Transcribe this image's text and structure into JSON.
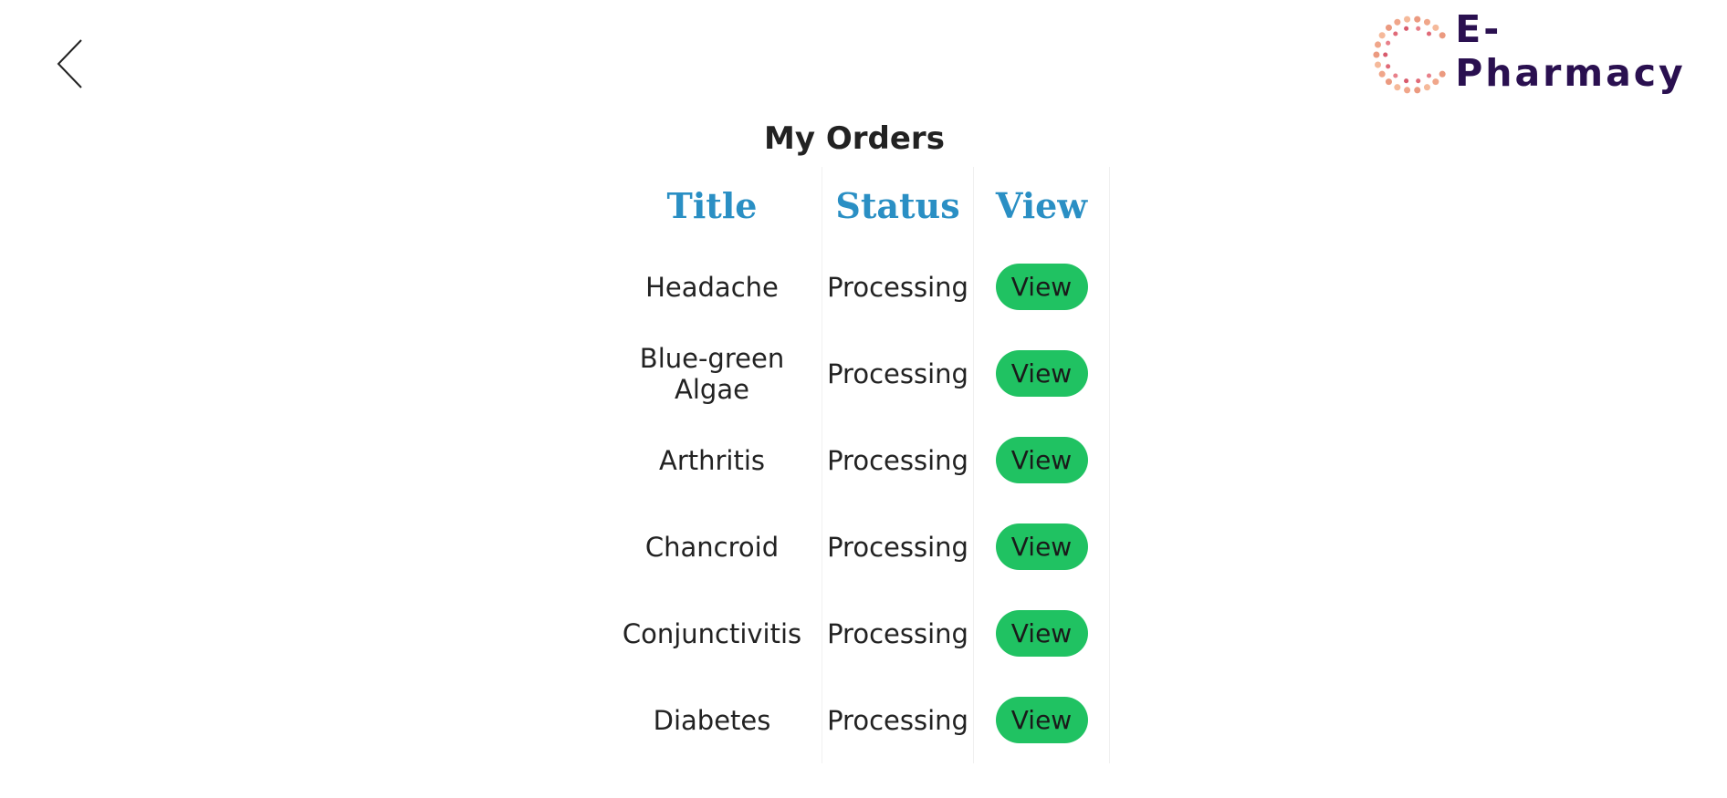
{
  "header": {
    "brand_name": "E-Pharmacy",
    "back_icon": "chevron-left-icon",
    "logo_icon": "dotted-circle-logo"
  },
  "main": {
    "title": "My Orders",
    "table": {
      "headers": [
        "Title",
        "Status",
        "View"
      ],
      "rows": [
        {
          "title": "Headache",
          "status": "Processing",
          "action": "View"
        },
        {
          "title": "Blue-green Algae",
          "status": "Processing",
          "action": "View"
        },
        {
          "title": "Arthritis",
          "status": "Processing",
          "action": "View"
        },
        {
          "title": "Chancroid",
          "status": "Processing",
          "action": "View"
        },
        {
          "title": "Conjunctivitis",
          "status": "Processing",
          "action": "View"
        },
        {
          "title": "Diabetes",
          "status": "Processing",
          "action": "View"
        }
      ]
    }
  },
  "colors": {
    "header_text": "#2a8fc4",
    "view_button": "#20c262",
    "brand_text": "#2a1050"
  }
}
